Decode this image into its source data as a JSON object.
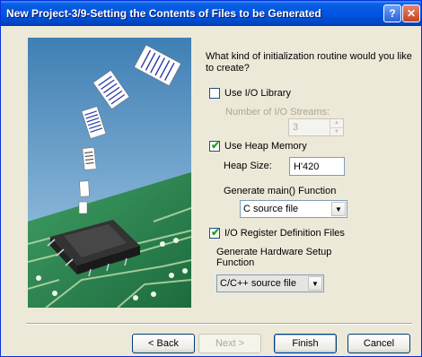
{
  "window": {
    "title": "New Project-3/9-Setting the Contents of Files to be Generated",
    "help_glyph": "?",
    "close_glyph": "✕"
  },
  "prompt": "What kind of initialization routine would you like to create?",
  "io_library": {
    "label": "Use I/O Library",
    "checked": false,
    "streams_label": "Number of I/O Streams:",
    "streams_value": "3",
    "up_glyph": "▲",
    "down_glyph": "▼"
  },
  "heap": {
    "label": "Use Heap Memory",
    "checked": true,
    "check_glyph": "✔",
    "size_label": "Heap Size:",
    "size_value": "H'420"
  },
  "main_function": {
    "label": "Generate main() Function",
    "value": "C source file",
    "arrow_glyph": "▼"
  },
  "io_register": {
    "label": "I/O Register Definition Files",
    "checked": true,
    "check_glyph": "✔"
  },
  "hardware_setup": {
    "label_line1": "Generate Hardware Setup",
    "label_line2": "Function",
    "value": "C/C++ source file",
    "arrow_glyph": "▼"
  },
  "buttons": {
    "back": "< Back",
    "next": "Next >",
    "finish": "Finish",
    "cancel": "Cancel"
  },
  "colors": {
    "titlebar": "#0054e3",
    "dialog_bg": "#ece9d8",
    "picture_sky": "#4a86b8",
    "circuit_board": "#2f8a55"
  }
}
